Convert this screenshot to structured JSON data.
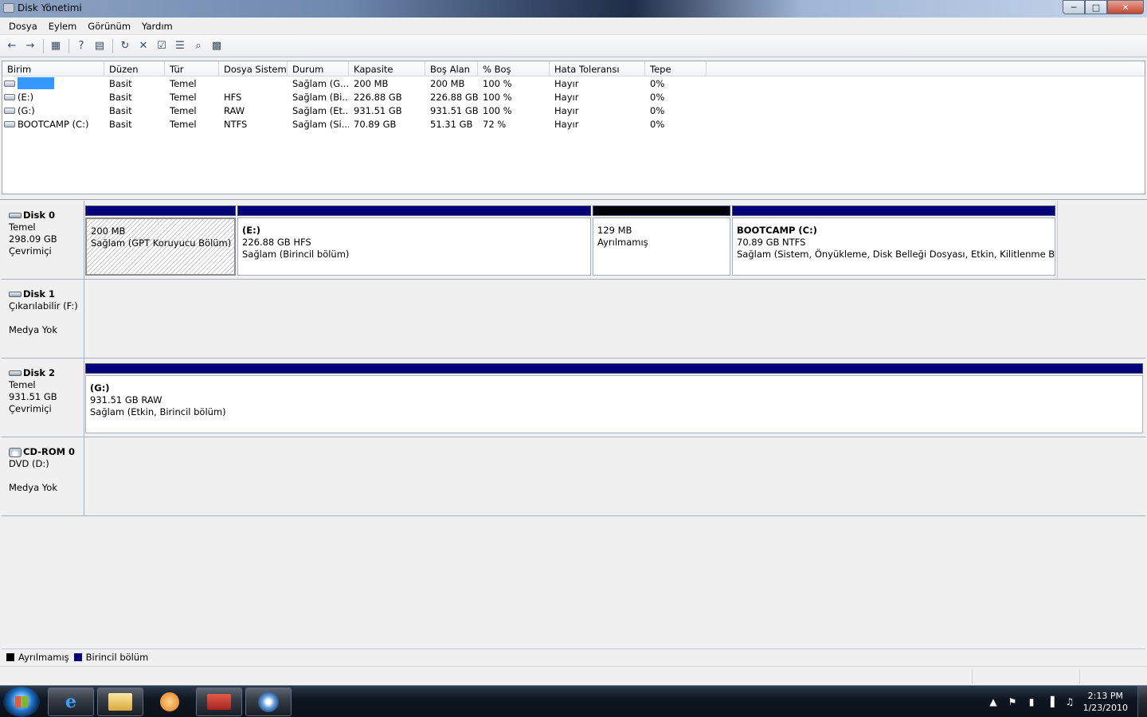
{
  "window": {
    "title": "Disk Yönetimi",
    "min": "─",
    "max": "□",
    "close": "✕"
  },
  "menu": [
    "Dosya",
    "Eylem",
    "Görünüm",
    "Yardım"
  ],
  "toolbar_icons": [
    "←",
    "→",
    "▦",
    "?",
    "▤",
    "↻",
    "✕",
    "☑",
    "☰",
    "⌕",
    "▩"
  ],
  "volume_table": {
    "headers": [
      "Birim",
      "Düzen",
      "Tür",
      "Dosya Sistemi",
      "Durum",
      "Kapasite",
      "Boş Alan",
      "% Boş",
      "Hata Toleransı",
      "Tepe"
    ],
    "rows": [
      {
        "name": "",
        "layout": "Basit",
        "type": "Temel",
        "fs": "",
        "status": "Sağlam (G...",
        "capacity": "200 MB",
        "free": "200 MB",
        "pct": "100 %",
        "fault": "Hayır",
        "overhead": "0%"
      },
      {
        "name": "(E:)",
        "layout": "Basit",
        "type": "Temel",
        "fs": "HFS",
        "status": "Sağlam (Bi...",
        "capacity": "226.88 GB",
        "free": "226.88 GB",
        "pct": "100 %",
        "fault": "Hayır",
        "overhead": "0%"
      },
      {
        "name": "(G:)",
        "layout": "Basit",
        "type": "Temel",
        "fs": "RAW",
        "status": "Sağlam (Et...",
        "capacity": "931.51 GB",
        "free": "931.51 GB",
        "pct": "100 %",
        "fault": "Hayır",
        "overhead": "0%"
      },
      {
        "name": "BOOTCAMP (C:)",
        "layout": "Basit",
        "type": "Temel",
        "fs": "NTFS",
        "status": "Sağlam (Si...",
        "capacity": "70.89 GB",
        "free": "51.31 GB",
        "pct": "72 %",
        "fault": "Hayır",
        "overhead": "0%"
      }
    ]
  },
  "disks": [
    {
      "name": "Disk 0",
      "line1": "Temel",
      "line2": "298.09 GB",
      "line3": "Çevrimiçi",
      "partitions": [
        {
          "title": "",
          "size": "200 MB",
          "status": "Sağlam (GPT Koruyucu Bölüm)"
        },
        {
          "title": "(E:)",
          "size": "226.88 GB HFS",
          "status": "Sağlam (Birincil bölüm)"
        },
        {
          "title": "",
          "size": "129 MB",
          "status": "Ayrılmamış"
        },
        {
          "title": "BOOTCAMP  (C:)",
          "size": "70.89 GB NTFS",
          "status": "Sağlam (Sistem, Önyükleme, Disk Belleği Dosyası, Etkin, Kilitlenme Bilgisi, B"
        }
      ]
    },
    {
      "name": "Disk 1",
      "line1": "Çıkarılabilir (F:)",
      "line2": "",
      "line3": "Medya Yok"
    },
    {
      "name": "Disk 2",
      "line1": "Temel",
      "line2": "931.51 GB",
      "line3": "Çevrimiçi",
      "partitions": [
        {
          "title": "(G:)",
          "size": "931.51 GB RAW",
          "status": "Sağlam (Etkin, Birincil bölüm)"
        }
      ]
    },
    {
      "name": "CD-ROM 0",
      "line1": "DVD (D:)",
      "line2": "",
      "line3": "Medya Yok"
    }
  ],
  "legend": [
    {
      "label": "Ayrılmamış",
      "color": "#000000"
    },
    {
      "label": "Birincil bölüm",
      "color": "#00007b"
    }
  ],
  "taskbar": {
    "ie_glyph": "e",
    "tray_icons": [
      "▲",
      "⚑",
      "▮",
      "▐",
      "♫"
    ],
    "time": "2:13 PM",
    "date": "1/23/2010"
  }
}
